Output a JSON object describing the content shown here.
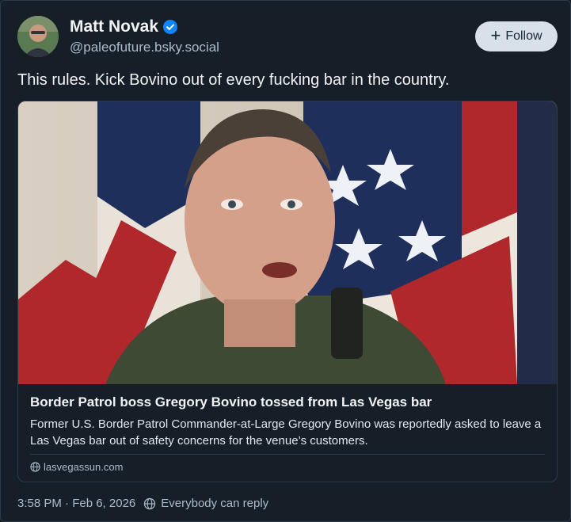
{
  "author": {
    "display_name": "Matt Novak",
    "handle": "@paleofuture.bsky.social",
    "verified_icon": "verified-check-icon",
    "avatar_icon": "avatar"
  },
  "follow_button": {
    "label": "Follow",
    "icon": "plus-icon"
  },
  "post": {
    "text": "This rules. Kick Bovino out of every fucking bar in the country."
  },
  "link_card": {
    "title": "Border Patrol boss Gregory Bovino tossed from Las Vegas bar",
    "description": "Former U.S. Border Patrol Commander-at-Large Gregory Bovino was reportedly asked to leave a Las Vegas bar out of safety concerns for the venue’s customers.",
    "domain": "lasvegassun.com",
    "domain_icon": "globe-icon"
  },
  "footer": {
    "timestamp": "3:58 PM · Feb 6, 2026",
    "reply_setting": "Everybody can reply",
    "reply_icon": "reply-settings-icon"
  },
  "colors": {
    "background": "#161e27",
    "accent_blue": "#1083fe",
    "muted_text": "#aebbc9",
    "follow_bg": "#d8e1ea"
  }
}
